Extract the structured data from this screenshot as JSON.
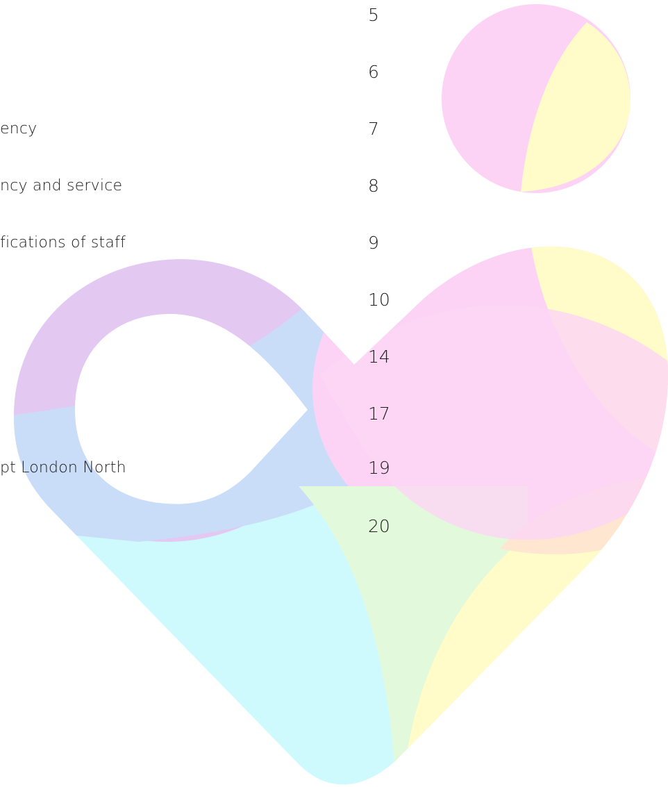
{
  "toc": {
    "entries": [
      {
        "title": "",
        "page": "5"
      },
      {
        "title": "",
        "page": "6"
      },
      {
        "title": "ency",
        "page": "7"
      },
      {
        "title": "ncy and service",
        "page": "8"
      },
      {
        "title": "fications of staff",
        "page": "9"
      },
      {
        "title": "",
        "page": "10"
      },
      {
        "title": "",
        "page": "14"
      },
      {
        "title": "",
        "page": "17"
      },
      {
        "title": "pt London North",
        "page": "19"
      },
      {
        "title": "",
        "page": "20"
      }
    ]
  },
  "watermark": {
    "icon": "heart-logo-icon",
    "colors": {
      "purple": "#e3c8f2",
      "blue": "#c9ddf8",
      "pink": "#fcd3f4",
      "yellow": "#fffcc9",
      "cyan": "#cffafd",
      "green": "#e2fadb",
      "peach": "#ffe6d0"
    }
  }
}
